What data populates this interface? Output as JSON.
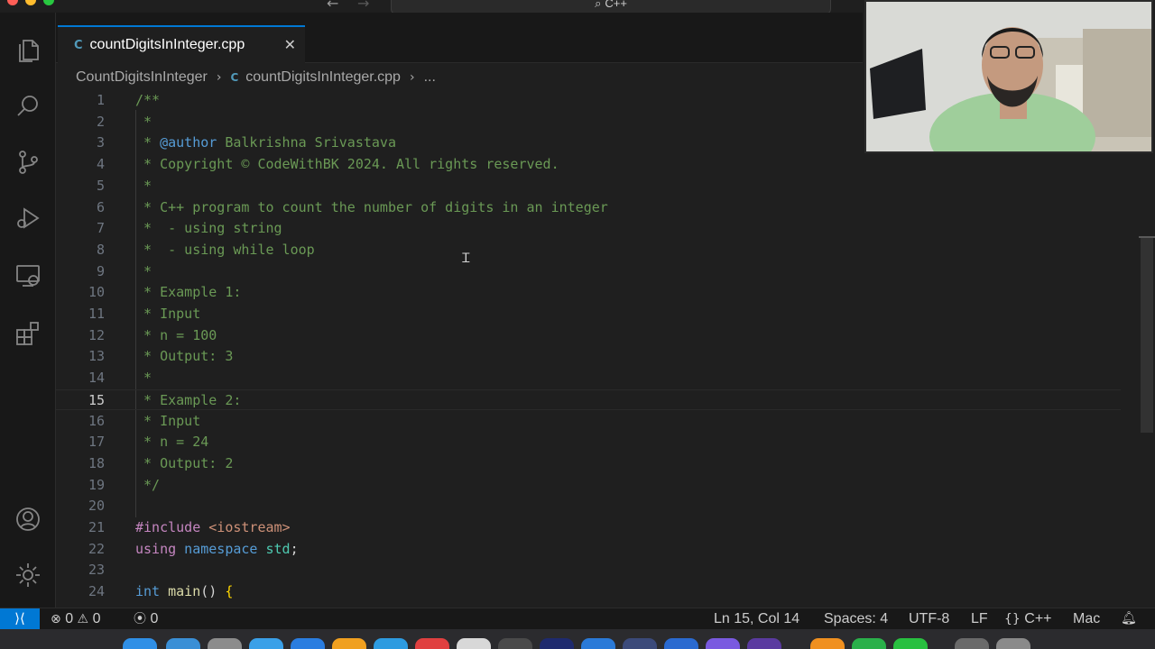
{
  "titlebar": {
    "command_center": "C++"
  },
  "activity_bar": {
    "items": [
      "explorer-icon",
      "search-icon",
      "source-control-icon",
      "run-debug-icon",
      "remote-explorer-icon",
      "extensions-icon",
      "accounts-icon",
      "manage-gear-icon"
    ]
  },
  "tab": {
    "icon": "C",
    "label": "countDigitsInInteger.cpp",
    "close": "✕"
  },
  "breadcrumb": {
    "folder": "CountDigitsInInteger",
    "file": "countDigitsInInteger.cpp",
    "more": "..."
  },
  "editor": {
    "active_line": 15,
    "lines": [
      {
        "n": "1",
        "text": "/**"
      },
      {
        "n": "2",
        "text": " *"
      },
      {
        "n": "3",
        "pre": " * ",
        "tag": "@author",
        "post": " Balkrishna Srivastava"
      },
      {
        "n": "4",
        "text": " * Copyright © CodeWithBK 2024. All rights reserved."
      },
      {
        "n": "5",
        "text": " *"
      },
      {
        "n": "6",
        "text": " * C++ program to count the number of digits in an integer"
      },
      {
        "n": "7",
        "text": " *  - using string"
      },
      {
        "n": "8",
        "text": " *  - using while loop"
      },
      {
        "n": "9",
        "text": " *"
      },
      {
        "n": "10",
        "text": " * Example 1:"
      },
      {
        "n": "11",
        "text": " * Input"
      },
      {
        "n": "12",
        "text": " * n = 100"
      },
      {
        "n": "13",
        "text": " * Output: 3"
      },
      {
        "n": "14",
        "text": " *"
      },
      {
        "n": "15",
        "text": " * Example 2:"
      },
      {
        "n": "16",
        "text": " * Input"
      },
      {
        "n": "17",
        "text": " * n = 24"
      },
      {
        "n": "18",
        "text": " * Output: 2"
      },
      {
        "n": "19",
        "text": " */"
      },
      {
        "n": "20",
        "text": ""
      },
      {
        "n": "21",
        "include_kw": "#include",
        "include_file": " <iostream>"
      },
      {
        "n": "22",
        "using": "using",
        "namespace": " namespace",
        "std": " std",
        "semi": ";"
      },
      {
        "n": "23",
        "text": ""
      },
      {
        "n": "24",
        "int": "int",
        "main": " main",
        "paren": "() ",
        "brace": "{"
      }
    ]
  },
  "status_bar": {
    "remote": "⟩⟨",
    "errors": "0",
    "warnings": "0",
    "ports": "0",
    "position": "Ln 15, Col 14",
    "spaces": "Spaces: 4",
    "encoding": "UTF-8",
    "eol": "LF",
    "language": "C++",
    "platform": "Mac"
  },
  "colors": {
    "accent": "#0078d4",
    "comment": "#6a9955",
    "keyword": "#c586c0",
    "string": "#ce9178"
  }
}
